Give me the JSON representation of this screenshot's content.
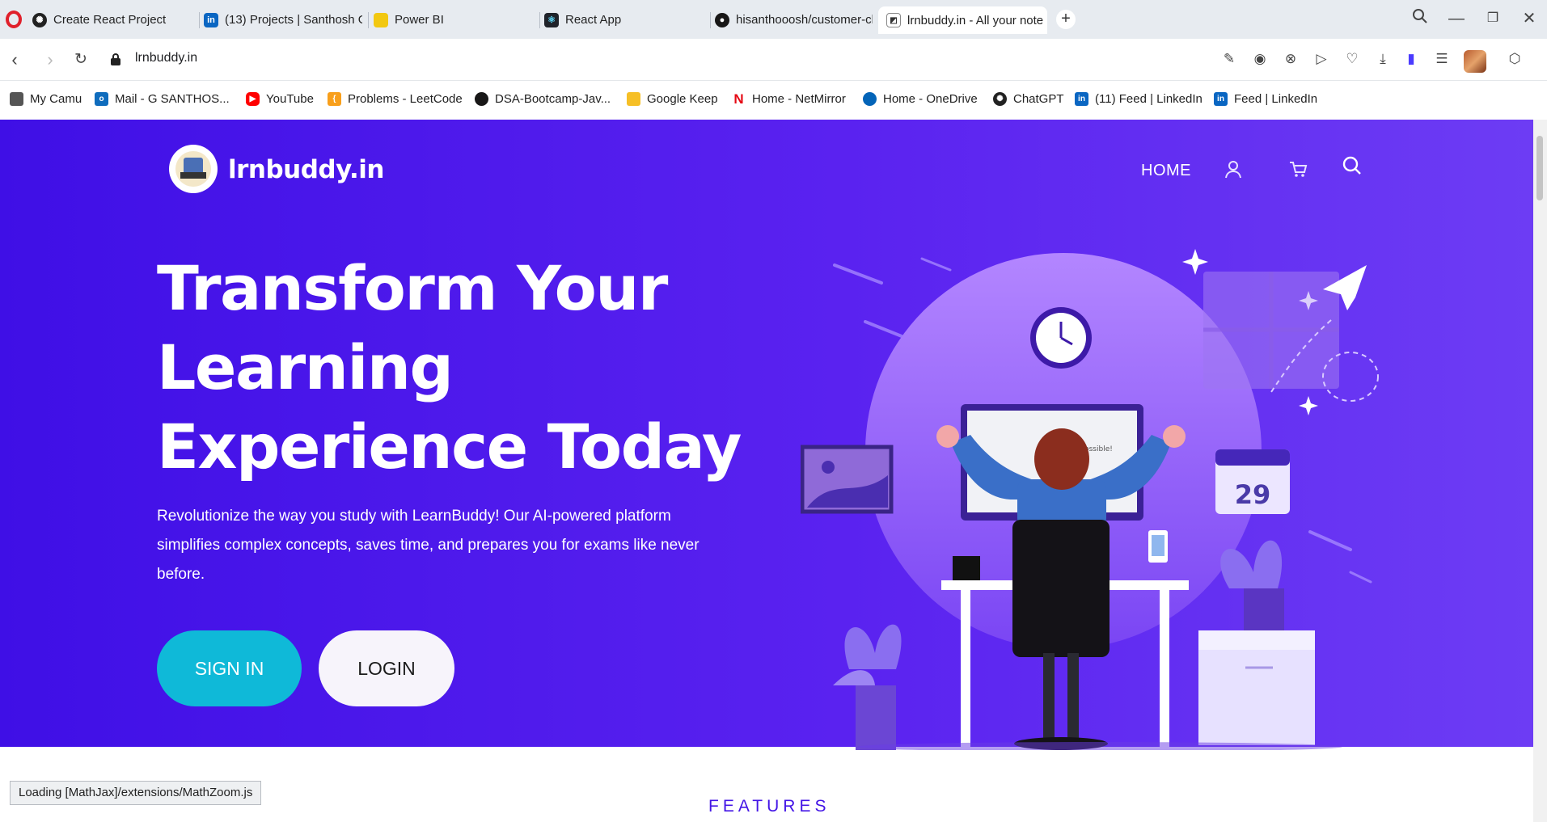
{
  "browser": {
    "tabs": [
      {
        "title": "Create React Project",
        "favicon_color": "#222222",
        "active": false
      },
      {
        "title": "(13) Projects | Santhosh G",
        "favicon_color": "#0a66c2",
        "active": false
      },
      {
        "title": "Power BI",
        "favicon_color": "#f2c811",
        "active": false
      },
      {
        "title": "React App",
        "favicon_color": "#20232a",
        "active": false
      },
      {
        "title": "hisanthooosh/customer-cl",
        "favicon_color": "#181717",
        "active": false
      },
      {
        "title": "lrnbuddy.in - All your note",
        "favicon_color": "#3f3f46",
        "active": true
      }
    ],
    "address": "lrnbuddy.in",
    "bookmarks": [
      {
        "label": "My Camu",
        "icon_color": "#444444"
      },
      {
        "label": "Mail - G SANTHOS...",
        "icon_color": "#0f6cbd"
      },
      {
        "label": "YouTube",
        "icon_color": "#ff0000"
      },
      {
        "label": "Problems - LeetCode",
        "icon_color": "#f89f1b"
      },
      {
        "label": "DSA-Bootcamp-Jav...",
        "icon_color": "#181717"
      },
      {
        "label": "Google Keep",
        "icon_color": "#f6bf26"
      },
      {
        "label": "Home - NetMirror",
        "icon_color": "#e50914"
      },
      {
        "label": "Home - OneDrive",
        "icon_color": "#0364b8"
      },
      {
        "label": "ChatGPT",
        "icon_color": "#222222"
      },
      {
        "label": "(11) Feed | LinkedIn",
        "icon_color": "#0a66c2"
      },
      {
        "label": "Feed | LinkedIn",
        "icon_color": "#0a66c2"
      }
    ],
    "status_text": "Loading [MathJax]/extensions/MathZoom.js"
  },
  "site": {
    "brand": "lrnbuddy.in",
    "logo_text": "LRN BUDDY",
    "nav": {
      "home": "HOME"
    },
    "hero": {
      "headline_lines": [
        "Transform Your",
        "Learning",
        "Experience Today"
      ],
      "subtext": "Revolutionize the way you study with LearnBuddy! Our AI-powered platform simplifies complex concepts, saves time, and prepares you for exams like never before.",
      "signin_label": "SIGN IN",
      "login_label": "LOGIN",
      "calendar_day": "29",
      "screen_text": "Possible!"
    },
    "features_label": "FEATURES"
  },
  "colors": {
    "hero_start": "#3f0fe6",
    "hero_end": "#6d3cf4",
    "signin_bg": "#0fb9d8",
    "accent": "#4416e6"
  }
}
